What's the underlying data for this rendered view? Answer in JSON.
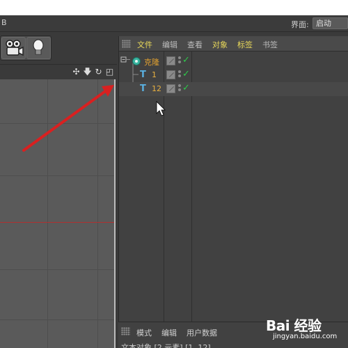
{
  "menubar": {
    "left_fragment": "B",
    "layout_label": "界面:",
    "layout_value": "启动"
  },
  "toolbar": {
    "buttons": [
      {
        "icon": "camera-icon"
      },
      {
        "icon": "light-bulb-icon"
      }
    ]
  },
  "viewport": {
    "header_icons": [
      "move-icon",
      "down-arrow-icon",
      "rotate-icon",
      "maximize-icon"
    ]
  },
  "object_manager": {
    "menu": [
      {
        "label": "文件",
        "color": "#e8d85a"
      },
      {
        "label": "编辑",
        "color": "#bdbdbd"
      },
      {
        "label": "查看",
        "color": "#bdbdbd"
      },
      {
        "label": "对象",
        "color": "#e8d85a"
      },
      {
        "label": "标签",
        "color": "#e8d85a"
      },
      {
        "label": "书签",
        "color": "#bdbdbd"
      }
    ],
    "rows": [
      {
        "name": "克隆",
        "type_icon": "cloner-icon",
        "color": "#e0a030",
        "checked": true
      },
      {
        "name": "1",
        "type_icon": "text-icon",
        "color": "#e8b040",
        "checked": true
      },
      {
        "name": "12",
        "type_icon": "text-icon",
        "color": "#e8b040",
        "checked": true
      }
    ]
  },
  "attributes": {
    "menu": [
      "模式",
      "编辑",
      "用户数据"
    ],
    "line": "文本对象 [2 元素] [1, 12]"
  },
  "watermark": {
    "main": "Bai 经验",
    "sub": "jingyan.baidu.com"
  },
  "colors": {
    "accent_arrow": "#d92020",
    "checkmark": "#2ec84a",
    "axis_red": "#b03030"
  }
}
